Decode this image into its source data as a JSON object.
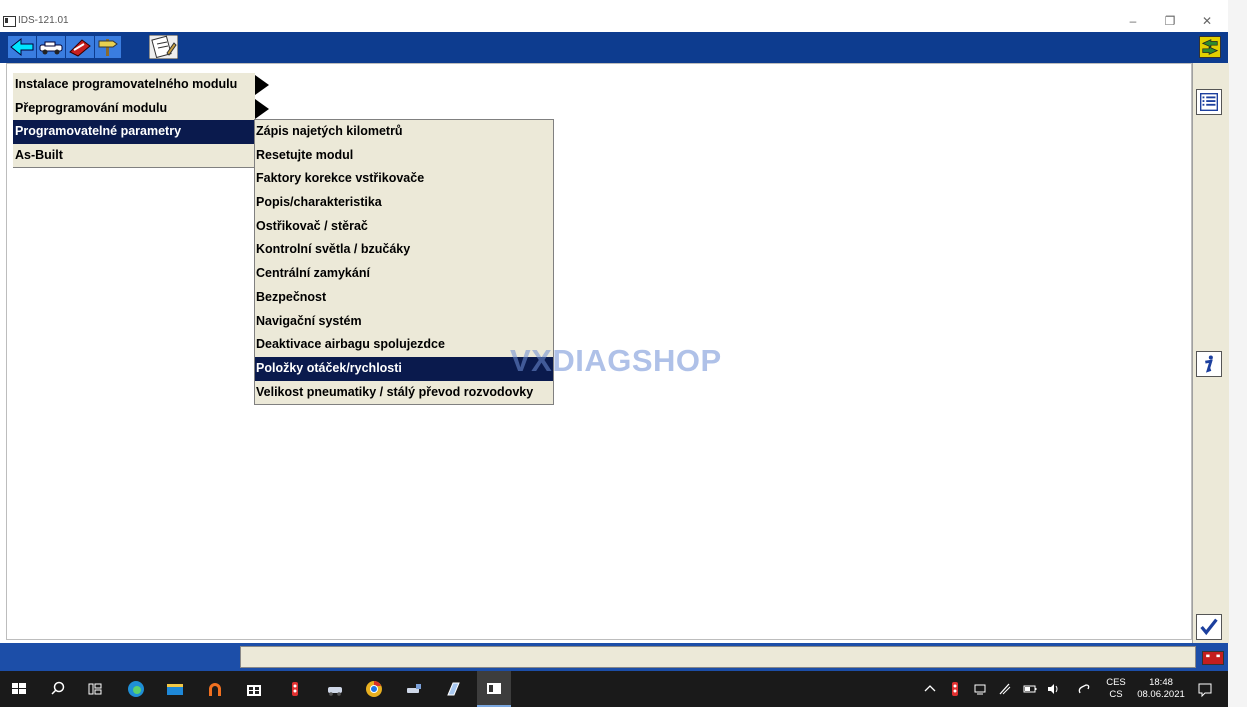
{
  "window": {
    "title": "IDS-121.01"
  },
  "menu": {
    "items": [
      {
        "label": "Instalace programovatelného modulu",
        "selected": false
      },
      {
        "label": "Přeprogramování modulu",
        "selected": false
      },
      {
        "label": "Programovatelné parametry",
        "selected": true
      },
      {
        "label": "As-Built",
        "selected": false
      }
    ]
  },
  "submenu": {
    "items": [
      {
        "label": "Zápis najetých kilometrů",
        "selected": false
      },
      {
        "label": "Resetujte modul",
        "selected": false
      },
      {
        "label": "Faktory korekce vstřikovače",
        "selected": false
      },
      {
        "label": "Popis/charakteristika",
        "selected": false
      },
      {
        "label": "Ostřikovač / stěrač",
        "selected": false
      },
      {
        "label": "Kontrolní světla / bzučáky",
        "selected": false
      },
      {
        "label": "Centrální zamykání",
        "selected": false
      },
      {
        "label": "Bezpečnost",
        "selected": false
      },
      {
        "label": "Navigační systém",
        "selected": false
      },
      {
        "label": "Deaktivace airbagu spolujezdce",
        "selected": false
      },
      {
        "label": "Položky otáček/rychlosti",
        "selected": true
      },
      {
        "label": "Velikost pneumatiky / stálý převod rozvodovky",
        "selected": false
      }
    ]
  },
  "watermark": "VXDIAGSHOP",
  "taskbar": {
    "lang_top": "CES",
    "lang_bottom": "CS",
    "time": "18:48",
    "date": "08.06.2021"
  },
  "colors": {
    "toolbar": "#0d3c8f",
    "selection": "#0a1a4d",
    "menu_bg": "#ece9d8",
    "statusbar": "#1c4ea8"
  },
  "icons": {
    "toolbar": [
      "back-arrow-icon",
      "vehicle-icon",
      "tools-icon",
      "signpost-icon",
      "notepad-icon",
      "swap-arrows-icon"
    ],
    "sidebar": [
      "list-icon",
      "info-icon",
      "checkmark-icon"
    ],
    "status": "battery-icon"
  }
}
